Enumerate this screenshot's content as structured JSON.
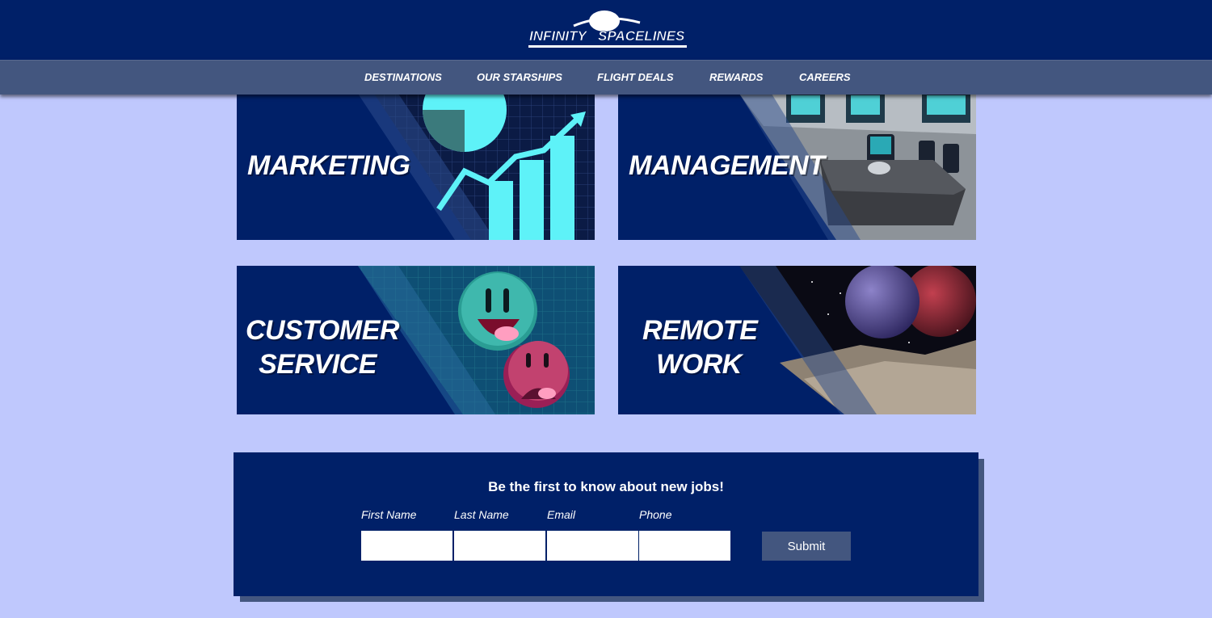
{
  "brand": {
    "name_line1": "INFINITY",
    "name_line2": "SPACELINES",
    "colors": {
      "header": "#002068",
      "nav": "#43567f",
      "background": "#bfc8fd",
      "accent": "#5ef2f8"
    }
  },
  "nav": {
    "items": [
      {
        "label": "DESTINATIONS"
      },
      {
        "label": "OUR STARSHIPS"
      },
      {
        "label": "FLIGHT DEALS"
      },
      {
        "label": "REWARDS"
      },
      {
        "label": "CAREERS"
      }
    ]
  },
  "careers": {
    "cards": [
      {
        "title": "MARKETING",
        "icon": "growth-chart-icon"
      },
      {
        "title": "MANAGEMENT",
        "icon": "conference-room-icon"
      },
      {
        "title": "CUSTOMER\nSERVICE",
        "icon": "emoji-faces-icon"
      },
      {
        "title": "REMOTE\nWORK",
        "icon": "planet-desert-icon"
      }
    ]
  },
  "signup": {
    "title": "Be the first to know about new jobs!",
    "fields": [
      {
        "label": "First Name",
        "value": ""
      },
      {
        "label": "Last Name",
        "value": ""
      },
      {
        "label": "Email",
        "value": ""
      },
      {
        "label": "Phone",
        "value": ""
      }
    ],
    "submit_label": "Submit"
  }
}
